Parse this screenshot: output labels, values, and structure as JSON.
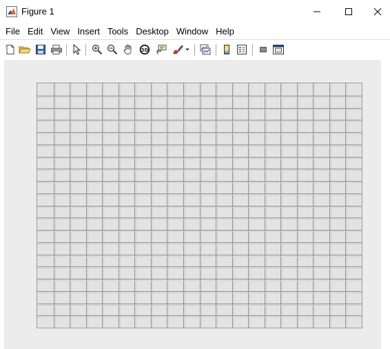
{
  "window": {
    "title": "Figure 1",
    "icon": "matlab-logo-icon",
    "controls": [
      "minimize-icon",
      "maximize-icon",
      "close-icon"
    ]
  },
  "menubar": {
    "items": [
      "File",
      "Edit",
      "View",
      "Insert",
      "Tools",
      "Desktop",
      "Window",
      "Help"
    ]
  },
  "toolbar": {
    "tools": [
      "new-figure-icon",
      "open-file-icon",
      "save-icon",
      "print-icon",
      "pointer-icon",
      "zoom-in-icon",
      "zoom-out-icon",
      "pan-hand-icon",
      "rotate-3d-icon",
      "data-cursor-icon",
      "brush-icon",
      "link-plot-icon",
      "colorbar-icon",
      "legend-icon",
      "hide-plot-tools-icon",
      "show-plot-tools-icon"
    ]
  },
  "colors": {
    "figure_background": "#ececec",
    "axes_background": "#e3e3e3",
    "grid_line": "#8f8f8f"
  },
  "grid": {
    "columns": 20,
    "rows": 20
  }
}
